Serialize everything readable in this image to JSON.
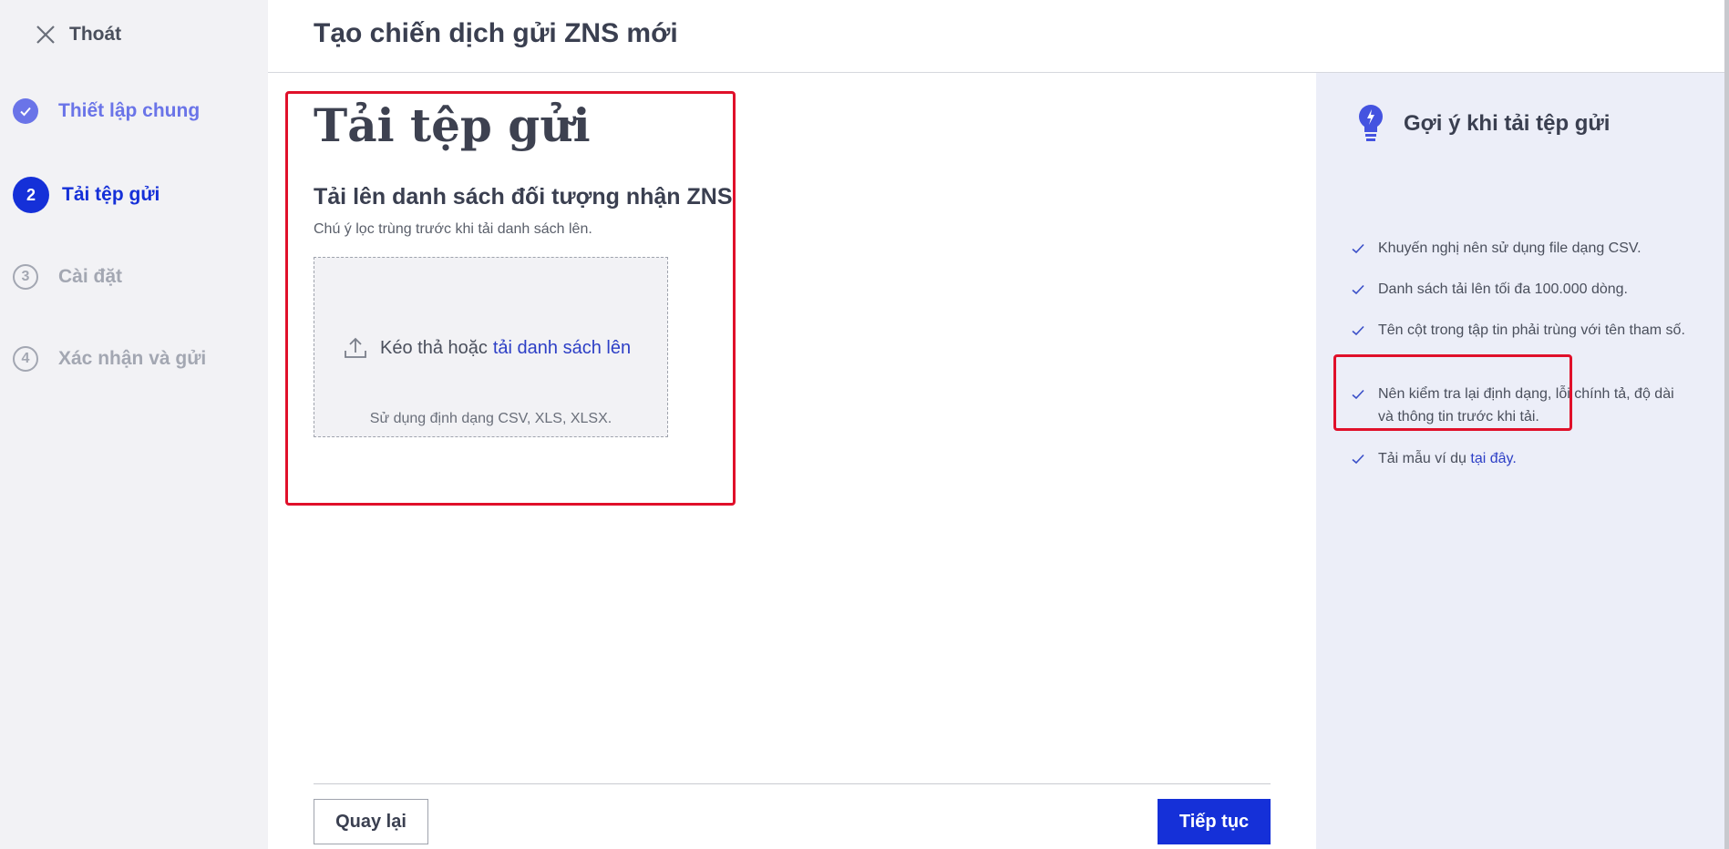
{
  "sidebar": {
    "exit_label": "Thoát",
    "steps": [
      {
        "number": "1",
        "label": "Thiết lập chung",
        "state": "done"
      },
      {
        "number": "2",
        "label": "Tải tệp gửi",
        "state": "active"
      },
      {
        "number": "3",
        "label": "Cài đặt",
        "state": "pending"
      },
      {
        "number": "4",
        "label": "Xác nhận và gửi",
        "state": "pending"
      }
    ]
  },
  "header": {
    "title": "Tạo chiến dịch gửi ZNS mới"
  },
  "main": {
    "section_title": "Tải tệp gửi",
    "subtitle": "Tải lên danh sách đối tượng nhận ZNS",
    "note": "Chú ý lọc trùng trước khi tải danh sách lên.",
    "dropzone": {
      "prompt": "Kéo thả hoặc",
      "link": "tải danh sách lên",
      "hint": "Sử dụng định dạng CSV, XLS, XLSX."
    }
  },
  "footer": {
    "back_label": "Quay lại",
    "next_label": "Tiếp tục"
  },
  "tips": {
    "title": "Gợi ý khi tải tệp gửi",
    "items": [
      "Khuyến nghị nên sử dụng file dạng CSV.",
      "Danh sách tải lên tối đa 100.000 dòng.",
      "Tên cột trong tập tin phải trùng với tên tham số.",
      "Nên kiểm tra lại định dạng, lỗi chính tả, độ dài và thông tin trước khi tải."
    ],
    "sample_prefix": "Tải mẫu ví dụ",
    "sample_link": "tại đây."
  },
  "colors": {
    "primary": "#1530d8",
    "done_step": "#6a74e8",
    "link": "#2d3fc6",
    "highlight_box": "#e0102a",
    "tips_background": "#eceef8",
    "sidebar_background": "#f2f2f5"
  },
  "icons": {
    "exit": "close-icon",
    "step_done": "checkmark-icon",
    "upload": "upload-icon",
    "tips": "lightbulb-icon",
    "tip_bullet": "check-icon"
  }
}
